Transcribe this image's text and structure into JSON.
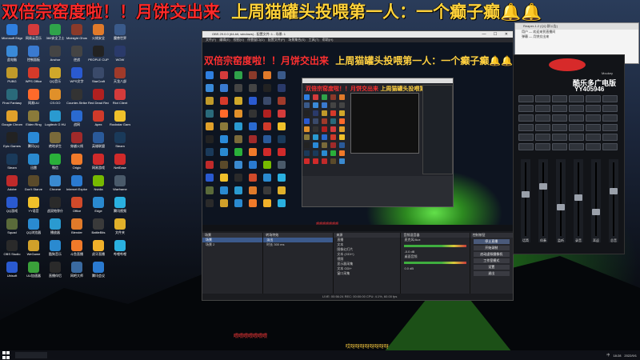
{
  "banner": {
    "part1": "双倍宗窑度啦！！月饼交出来",
    "part2": "上周猫罐头投喂第一人：一个癫子癫🔔🔔"
  },
  "desktop_icons": [
    {
      "label": "Microsoft Edge",
      "color": "#2f7fe0",
      "icon": "edge-icon"
    },
    {
      "label": "网易云音乐",
      "color": "#d43b3b",
      "icon": "music-icon"
    },
    {
      "label": "360安全卫士",
      "color": "#2fa34a",
      "icon": "shield-icon"
    },
    {
      "label": "Midnight Ghost Hunt",
      "color": "#8a3a2a",
      "icon": "game-icon"
    },
    {
      "label": "火绒安全",
      "color": "#e07a2a",
      "icon": "app-icon"
    },
    {
      "label": "魔兽世界",
      "color": "#3a5a8a",
      "icon": "wow-icon"
    },
    {
      "label": "此电脑",
      "color": "#3a8ad8",
      "icon": "computer-icon"
    },
    {
      "label": "控制面板",
      "color": "#3a7ad0",
      "icon": "control-panel-icon"
    },
    {
      "label": "Anchor",
      "color": "#444",
      "icon": "anchor-icon"
    },
    {
      "label": "逆战",
      "color": "#444",
      "icon": "game-icon"
    },
    {
      "label": "PEOPLE CUP",
      "color": "#222",
      "icon": "app-icon"
    },
    {
      "label": "WOW",
      "color": "#2a3a6a",
      "icon": "wow-icon"
    },
    {
      "label": "PUBG",
      "color": "#c09a2a",
      "icon": "pubg-icon"
    },
    {
      "label": "WPS Office",
      "color": "#d63a2a",
      "icon": "wps-icon"
    },
    {
      "label": "QQ音乐",
      "color": "#d0a82a",
      "icon": "app-icon"
    },
    {
      "label": "WPS文字",
      "color": "#2a5ad0",
      "icon": "doc-icon"
    },
    {
      "label": "StarCraft",
      "color": "#3a4a6a",
      "icon": "game-icon"
    },
    {
      "label": "天龙八部",
      "color": "#a03a2a",
      "icon": "game-icon"
    },
    {
      "label": "Final Fantasy",
      "color": "#2a6a7a",
      "icon": "game-icon"
    },
    {
      "label": "网易UU",
      "color": "#ff6a2a",
      "icon": "app-icon"
    },
    {
      "label": "CS:GO",
      "color": "#e0902a",
      "icon": "csgo-icon"
    },
    {
      "label": "Counter-Strike",
      "color": "#333",
      "icon": "game-icon"
    },
    {
      "label": "Red Dead Redemption",
      "color": "#b02020",
      "icon": "game-icon"
    },
    {
      "label": "Riot Client",
      "color": "#d43b3b",
      "icon": "riot-icon"
    },
    {
      "label": "Google Chrome",
      "color": "#e0a02a",
      "icon": "chrome-icon"
    },
    {
      "label": "Elden Ring",
      "color": "#8a7a3a",
      "icon": "game-icon"
    },
    {
      "label": "Logitech G HUB",
      "color": "#2a9ad0",
      "icon": "logitech-icon"
    },
    {
      "label": "战网",
      "color": "#2a6ad0",
      "icon": "battlenet-icon"
    },
    {
      "label": "Apex",
      "color": "#d03a2a",
      "icon": "game-icon"
    },
    {
      "label": "Rockstar Games",
      "color": "#f0c02a",
      "icon": "rockstar-icon"
    },
    {
      "label": "Epic Games",
      "color": "#222",
      "icon": "epic-icon"
    },
    {
      "label": "腾讯QQ",
      "color": "#2a8ad8",
      "icon": "qq-icon"
    },
    {
      "label": "绝地求生",
      "color": "#7a6a3a",
      "icon": "game-icon"
    },
    {
      "label": "穿越火线",
      "color": "#a02a2a",
      "icon": "game-icon"
    },
    {
      "label": "英雄联盟",
      "color": "#2a5a9a",
      "icon": "lol-icon"
    },
    {
      "label": "Steam",
      "color": "#1a3a5a",
      "icon": "steam-icon"
    },
    {
      "label": "Steam",
      "color": "#1a3a5a",
      "icon": "steam-icon"
    },
    {
      "label": "迅雷",
      "color": "#2a8ad0",
      "icon": "thunder-icon"
    },
    {
      "label": "微信",
      "color": "#2ab03a",
      "icon": "wechat-icon"
    },
    {
      "label": "Origin",
      "color": "#f07a2a",
      "icon": "origin-icon"
    },
    {
      "label": "网易游戏",
      "color": "#d02a2a",
      "icon": "app-icon"
    },
    {
      "label": "NetEase",
      "color": "#d02a2a",
      "icon": "app-icon"
    },
    {
      "label": "Adobe",
      "color": "#c02a2a",
      "icon": "adobe-icon"
    },
    {
      "label": "Don't Starve",
      "color": "#5a4a2a",
      "icon": "game-icon"
    },
    {
      "label": "Chrome",
      "color": "#3a8ad0",
      "icon": "chrome-icon"
    },
    {
      "label": "Internet Explorer",
      "color": "#2a7ad0",
      "icon": "ie-icon"
    },
    {
      "label": "Nvidia",
      "color": "#76b900",
      "icon": "nvidia-icon"
    },
    {
      "label": "Warframe",
      "color": "#4a5a6a",
      "icon": "game-icon"
    },
    {
      "label": "QQ游戏",
      "color": "#2a5ad0",
      "icon": "app-icon"
    },
    {
      "label": "YY语音",
      "color": "#f0c02a",
      "icon": "yy-icon"
    },
    {
      "label": "战双帕弥什",
      "color": "#2a2a2a",
      "icon": "game-icon"
    },
    {
      "label": "Office",
      "color": "#d04a2a",
      "icon": "office-icon"
    },
    {
      "label": "Edge",
      "color": "#2a8ad0",
      "icon": "edge-icon"
    },
    {
      "label": "腾讯视频",
      "color": "#2ab0e0",
      "icon": "video-icon"
    },
    {
      "label": "Squad",
      "color": "#5a6a3a",
      "icon": "game-icon"
    },
    {
      "label": "QQ浏览器",
      "color": "#2a8ad0",
      "icon": "browser-icon"
    },
    {
      "label": "播放器",
      "color": "#2a9ad0",
      "icon": "player-icon"
    },
    {
      "label": "Blender",
      "color": "#e07a2a",
      "icon": "blender-icon"
    },
    {
      "label": "BattleBits",
      "color": "#3a3a3a",
      "icon": "game-icon"
    },
    {
      "label": "文件夹",
      "color": "#e0b02a",
      "icon": "folder-icon"
    },
    {
      "label": "OBS Studio",
      "color": "#2a2a2a",
      "icon": "obs-icon"
    },
    {
      "label": "WeGame",
      "color": "#d0a02a",
      "icon": "wegame-icon"
    },
    {
      "label": "酷狗音乐",
      "color": "#2a8ad0",
      "icon": "kugou-icon"
    },
    {
      "label": "斗鱼直播",
      "color": "#f07a2a",
      "icon": "douyu-icon"
    },
    {
      "label": "虎牙直播",
      "color": "#f0b02a",
      "icon": "huya-icon"
    },
    {
      "label": "哔哩哔哩",
      "color": "#2ab0e0",
      "icon": "bilibili-icon"
    },
    {
      "label": "Ubisoft",
      "color": "#2a5ad0",
      "icon": "ubisoft-icon"
    },
    {
      "label": "UU加速器",
      "color": "#3aa03a",
      "icon": "app-icon"
    },
    {
      "label": "直播伴侣",
      "color": "#2a2a2a",
      "icon": "app-icon"
    },
    {
      "label": "网吧大师",
      "color": "#3a6aa0",
      "icon": "app-icon"
    },
    {
      "label": "腾讯会议",
      "color": "#2a7ad0",
      "icon": "app-icon"
    }
  ],
  "obs": {
    "title": "OBS 29.0.0 (64-bit, windows) - 配置文件: 1 - 场景: 1",
    "menu": "文件(F)  编辑(E)  视图(V)  停靠窗口(D)  配置文件(P)  场景集合(S)  工具(T)  帮助(H)",
    "preview_subtitle": "喂喂喂喂喂喂喂",
    "docks": {
      "scenes_title": "场景",
      "scene_items": [
        "场景",
        "场景 2"
      ],
      "sources_title": "来源",
      "source_items": [
        "直播",
        "文本",
        "图像幻灯片",
        "文本 (GDI+)",
        "视频",
        "显示器采集",
        "文本 GDI+",
        "窗口采集"
      ],
      "mixer_title": "音频混音器",
      "mixer_items": [
        {
          "name": "麦克风/Aux",
          "level": "-0.0 dB"
        },
        {
          "name": "桌面音频",
          "level": "0.0 dB"
        }
      ],
      "transitions_title": "转场特效",
      "transition_value": "淡出",
      "duration_label": "时长",
      "duration_value": "300 ms",
      "controls_title": "控制按钮",
      "controls": [
        "停止直播",
        "开始录制",
        "启动虚拟摄像机",
        "工作室模式",
        "设置",
        "退出"
      ]
    },
    "status": "LIVE: 00:56:24   REC: 00:00:00   CPU: 4.1%, 60.00 fps"
  },
  "chat": {
    "title": "Reaper-1.2 (QQ 群公告)",
    "messages": [
      "用户 — 欢迎来到直播间",
      "弹幕 — 月饼交出来"
    ]
  },
  "mixer_app": {
    "brand": "Moukey",
    "name": "酷乐多广电版",
    "id": "YY405946",
    "channels": [
      "话筒",
      "伴奏",
      "监听",
      "录音",
      "耳返",
      "总音"
    ]
  },
  "subtitles": {
    "red": "喂喂喂喂喂喂喂",
    "yellow": "哎呀呀呀呀呀呀呀呀"
  },
  "taskbar": {
    "time": "18:28",
    "date": "2022/9/1",
    "lang": "中"
  }
}
